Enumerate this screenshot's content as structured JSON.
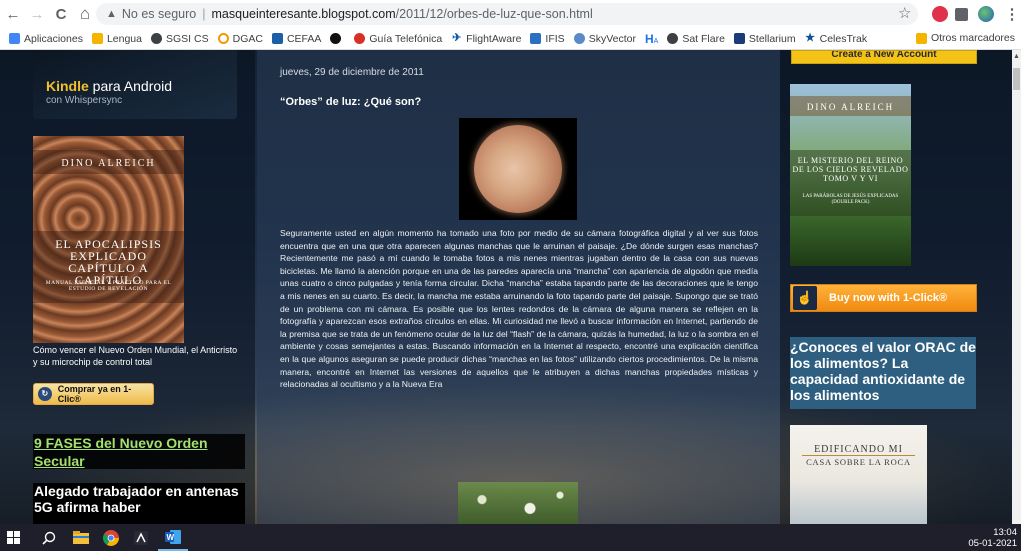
{
  "browser": {
    "nav": {
      "back": "←",
      "forward": "→",
      "reload": "C",
      "home": "⌂"
    },
    "address": {
      "security_label": "No es seguro",
      "separator": "|",
      "host": "masqueinteresante.blogspot.com",
      "path": "/2011/12/orbes-de-luz-que-son.html"
    },
    "menu_glyph": "⋮",
    "bookmarks": [
      {
        "label": "Aplicaciones",
        "color": "#4285f4"
      },
      {
        "label": "Lengua",
        "color": "#f4b400"
      },
      {
        "label": "SGSI CS",
        "color": "#3c4043"
      },
      {
        "label": "DGAC",
        "color": "#f29900"
      },
      {
        "label": "CEFAA",
        "color": "#1a5fa8"
      },
      {
        "label": "",
        "color": "#111111"
      },
      {
        "label": "Guía Telefónica",
        "color": "#d93025"
      },
      {
        "label": "FlightAware",
        "color": "#0a5aa8"
      },
      {
        "label": "IFIS",
        "color": "#2b6fc2"
      },
      {
        "label": "SkyVector",
        "color": "#5a8ac8"
      },
      {
        "label": "H",
        "color": "#1a73e8"
      },
      {
        "label": "Sat Flare",
        "color": "#3c4043"
      },
      {
        "label": "Stellarium",
        "color": "#1d3a7a"
      },
      {
        "label": "CelesTrak",
        "color": "#0b5394"
      }
    ],
    "other_bookmarks": "Otros marcadores"
  },
  "left": {
    "kindle_title": "Kindle",
    "kindle_title_rest": "para Android",
    "kindle_sub": "con Whispersync",
    "book1_author": "Dino Alreich",
    "book1_title": "El Apocalipsis explicado capítulo a capítulo",
    "book1_subtitle": "Manual esencial y práctico para el estudio de Revelación",
    "book1_caption": "Cómo vencer el Nuevo Orden Mundial, el Anticristo y su microchip de control total",
    "buy_button": "Comprar ya en 1-Clic®",
    "link_9fases": "9 FASES del Nuevo Orden Secular",
    "alegado_headline": "Alegado trabajador en antenas 5G afirma haber"
  },
  "post": {
    "date": "jueves, 29 de diciembre de 2011",
    "title": "“Orbes” de luz: ¿Qué son?",
    "body": "Seguramente usted en algún momento ha tomado una foto por medio de su cámara fotográfica digital y al ver sus fotos encuentra que en una que otra aparecen algunas manchas que le arruinan el paisaje. ¿De dónde surgen esas manchas? Recientemente me pasó a mí cuando le tomaba fotos a mis nenes mientras jugaban dentro de la casa con sus nuevas bicicletas. Me llamó la atención porque en una de las paredes aparecía una “mancha” con apariencia de algodón que medía unas cuatro o cinco pulgadas y tenía forma circular. Dicha “mancha” estaba tapando parte de las decoraciones que le tengo a mis nenes en su cuarto. Es decir, la mancha me estaba arruinando la foto tapando parte del paisaje. Supongo que se trató de un problema con mi cámara. Es posible que los lentes redondos de la cámara de alguna manera se reflejen en la fotografía y aparezcan esos extraños círculos en ellas. Mi curiosidad me llevó a buscar información en Internet, partiendo de la premisa que se trata de un fenómeno ocular de la luz del “flash” de la cámara, quizás la humedad, la luz o la sombra en el ambiente y cosas semejantes a estas. Buscando información en la Internet al respecto, encontré una explicación científica en la que algunos aseguran se puede producir dichas “manchas en las fotos” utilizando ciertos procedimientos. De la misma manera, encontré en Internet las versiones de aquellos que le atribuyen a dichas manchas propiedades místicas y relacionadas al ocultismo y a la Nueva Era"
  },
  "right": {
    "create_account": "Create a New Account",
    "book2_author": "Dino Alreich",
    "book2_title": "El misterio del reino de los cielos revelado Tomo V y VI",
    "book2_subtitle": "Las parábolas de Jesús explicadas (Double Pack)",
    "buy_now": "Buy now with 1-Click®",
    "orac_ad": "¿Conoces el valor ORAC de los alimentos? La capacidad antioxidante de los alimentos",
    "book3_title": "Edificando mi",
    "book3_title2": "casa sobre la roca"
  },
  "taskbar": {
    "time": "13:04",
    "date": "05-01-2021"
  },
  "colors": {
    "link_green": "#a3e06d",
    "amazon_orange": "#f08a10",
    "ad_blue": "#2e5f80"
  }
}
